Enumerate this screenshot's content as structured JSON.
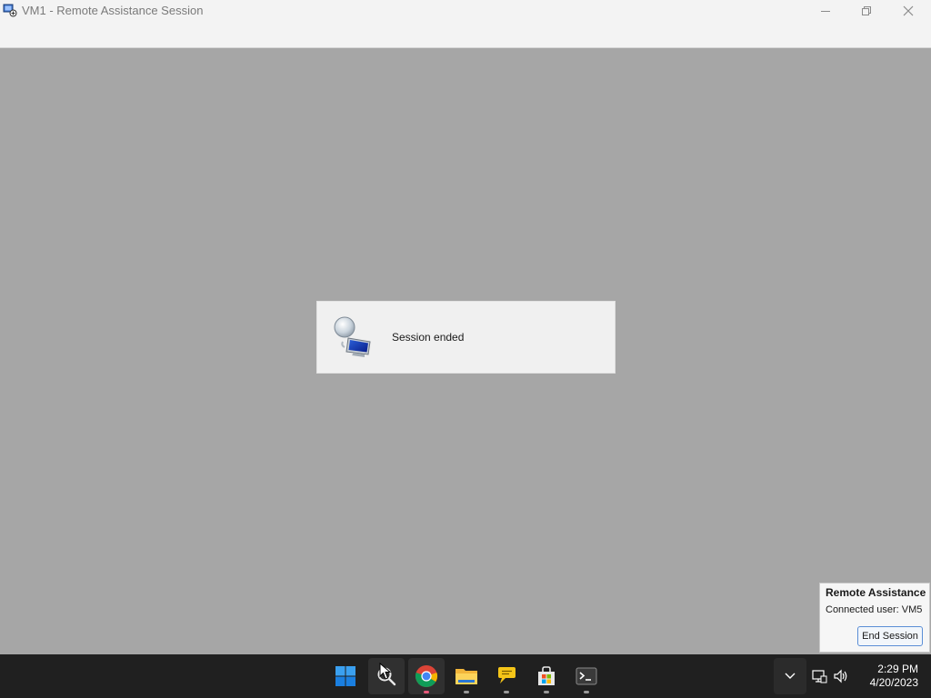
{
  "window": {
    "title": "VM1 - Remote Assistance Session",
    "controls": {
      "minimize": "minimize-icon",
      "maximize": "restore-icon",
      "close": "close-icon"
    }
  },
  "dialog": {
    "message": "Session ended",
    "icon": "remote-assistance-monitor-icon"
  },
  "remote_assistance_panel": {
    "title": "Remote Assistance",
    "connected_user_label": "Connected user:  VM5",
    "end_button_label": "End Session"
  },
  "taskbar": {
    "items": [
      {
        "name": "start",
        "icon": "windows-start-icon"
      },
      {
        "name": "search",
        "icon": "search-icon"
      },
      {
        "name": "chrome",
        "icon": "chrome-icon"
      },
      {
        "name": "file-explorer",
        "icon": "folder-icon"
      },
      {
        "name": "feedback",
        "icon": "chat-bubble-icon"
      },
      {
        "name": "store",
        "icon": "store-icon"
      },
      {
        "name": "terminal",
        "icon": "terminal-icon"
      }
    ],
    "tray": {
      "time": "2:29 PM",
      "date": "4/20/2023"
    }
  },
  "colors": {
    "background": "#a6a6a6",
    "titlebar": "#f3f3f3",
    "taskbar": "#202020",
    "accent_blue": "#0078d4"
  }
}
